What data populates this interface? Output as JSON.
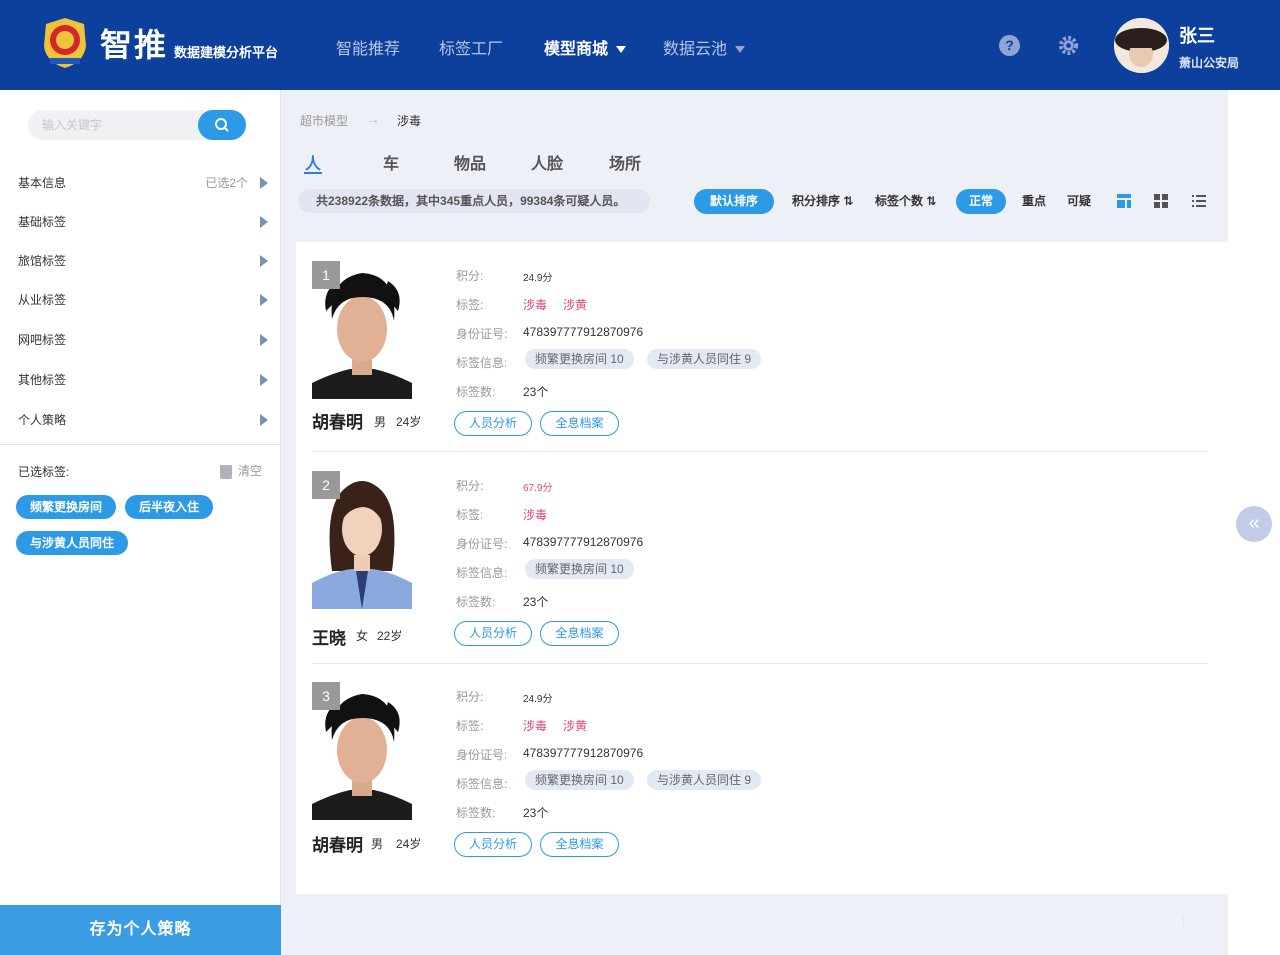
{
  "header": {
    "brand_title": "智推",
    "brand_subtitle": "数据建模分析平台",
    "nav": [
      {
        "label": "智能推荐"
      },
      {
        "label": "标签工厂"
      },
      {
        "label": "模型商城"
      },
      {
        "label": "数据云池"
      }
    ],
    "user": {
      "name": "张三",
      "org": "萧山公安局"
    },
    "help_icon": "help-icon",
    "settings_icon": "gear-icon"
  },
  "sidebar": {
    "search_placeholder": "输入关键字",
    "items": [
      {
        "label": "基本信息",
        "value": "已选2个"
      },
      {
        "label": "基础标签"
      },
      {
        "label": "旅馆标签"
      },
      {
        "label": "从业标签"
      },
      {
        "label": "网吧标签"
      },
      {
        "label": "其他标签"
      },
      {
        "label": "个人策略"
      }
    ],
    "selected_label": "已选标签:",
    "clear_label": "清空",
    "chips": [
      "频繁更换房间",
      "后半夜入住",
      "与涉黄人员同住"
    ],
    "save_label": "存为个人策略"
  },
  "main": {
    "breadcrumb": [
      "超市模型",
      "涉毒"
    ],
    "tabs": [
      "人",
      "车",
      "物品",
      "人脸",
      "场所"
    ],
    "summary": "共238922条数据，其中345重点人员，99384条可疑人员。",
    "sort": {
      "default": "默认排序",
      "score": "积分排序",
      "tag_count": "标签个数"
    },
    "filters": [
      "正常",
      "重点",
      "可疑"
    ],
    "field_labels": {
      "score": "积分:",
      "tags": "标签:",
      "id": "身份证号:",
      "tag_info": "标签信息:",
      "tag_count": "标签数:"
    },
    "buttons": {
      "analysis": "人员分析",
      "archive": "全息档案"
    },
    "accent": "#2d9ae6",
    "tag_color": "#e0457b",
    "persons": [
      {
        "rank": "1",
        "name": "胡春明",
        "gender": "男",
        "age": "24岁",
        "score": "24.9分",
        "tags": [
          "涉毒",
          "涉黄"
        ],
        "id": "478397777912870976",
        "tag_info": [
          "频繁更换房间 10",
          "与涉黄人员同住 9"
        ],
        "tag_count": "23个"
      },
      {
        "rank": "2",
        "name": "王晓",
        "gender": "女",
        "age": "22岁",
        "score": "67.9分",
        "tags": [
          "涉毒"
        ],
        "id": "478397777912870976",
        "tag_info": [
          "频繁更换房间 10"
        ],
        "tag_count": "23个"
      },
      {
        "rank": "3",
        "name": "胡春明",
        "gender": "男",
        "age": "24岁",
        "score": "24.9分",
        "tags": [
          "涉毒",
          "涉黄"
        ],
        "id": "478397777912870976",
        "tag_info": [
          "频繁更换房间 10",
          "与涉黄人员同住 9"
        ],
        "tag_count": "23个"
      }
    ]
  }
}
